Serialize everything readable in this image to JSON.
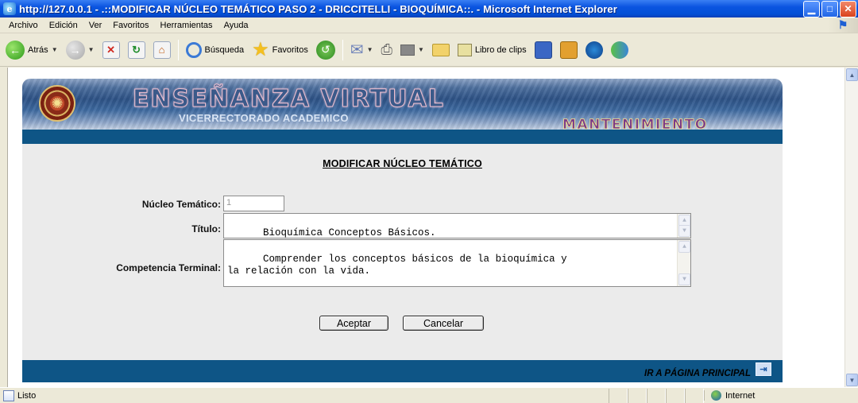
{
  "window": {
    "title": "http://127.0.0.1 - .::MODIFICAR NÚCLEO TEMÁTICO PASO 2 - DRICCITELLI - BIOQUÍMICA::. - Microsoft Internet Explorer",
    "minimize": "▁",
    "maximize": "□",
    "close": "✕"
  },
  "menu": [
    "Archivo",
    "Edición",
    "Ver",
    "Favoritos",
    "Herramientas",
    "Ayuda"
  ],
  "toolbar": {
    "back_label": "Atrás",
    "search_label": "Búsqueda",
    "favorites_label": "Favoritos",
    "clips_label": "Libro de clips"
  },
  "banner": {
    "title": "ENSEÑANZA VIRTUAL",
    "subtitle": "VICERRECTORADO ACADEMICO",
    "section": "MANTENIMIENTO"
  },
  "form": {
    "heading": "MODIFICAR NÚCLEO TEMÁTICO",
    "nucleo_label": "Núcleo Temático:",
    "nucleo_value": "1",
    "titulo_label": "Título:",
    "titulo_value": "Bioquímica Conceptos Básicos.",
    "competencia_label": "Competencia Terminal:",
    "competencia_value": "Comprender los conceptos básicos de la bioquímica y\nla relación con la vida.",
    "accept_label": "Aceptar",
    "cancel_label": "Cancelar"
  },
  "footer": {
    "link_label": "IR A PÁGINA PRINCIPAL"
  },
  "status": {
    "text": "Listo",
    "zone": "Internet"
  },
  "colors": {
    "ie_titlebar": "#0a54e0",
    "header_bar": "#0e5586",
    "panel_bg": "#ebebeb"
  }
}
